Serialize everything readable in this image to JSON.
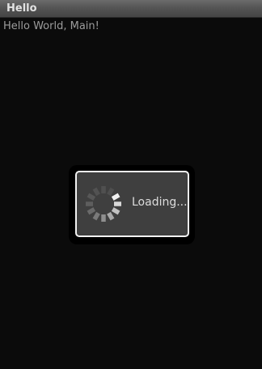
{
  "app": {
    "title": "Hello"
  },
  "main": {
    "text": "Hello World, Main!"
  },
  "progress_dialog": {
    "message": "Loading...",
    "spinner_icon": "progress-spinner-icon"
  },
  "colors": {
    "background": "#0b0b0b",
    "dialog_background": "#3f3f3f",
    "dialog_border": "#f2f2f2"
  }
}
